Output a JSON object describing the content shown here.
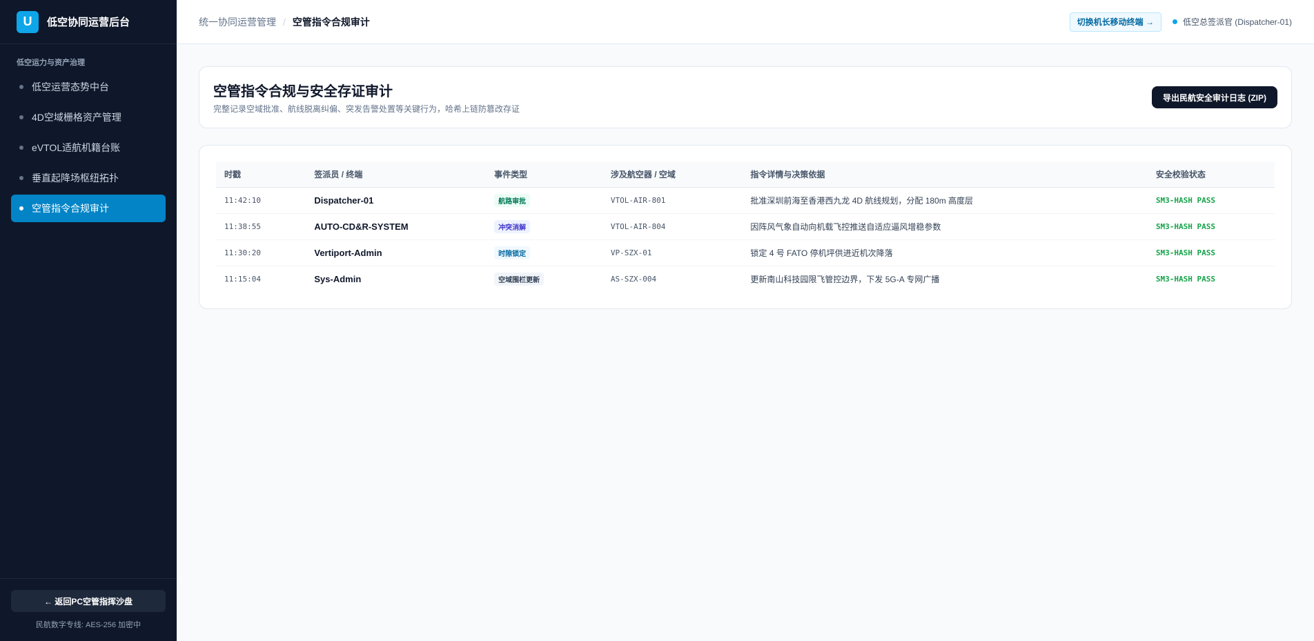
{
  "sidebar": {
    "logo_letter": "U",
    "brand_title": "低空协同运营后台",
    "section_title": "低空运力与资产治理",
    "items": [
      {
        "label": "低空运营态势中台",
        "active": false
      },
      {
        "label": "4D空域栅格资产管理",
        "active": false
      },
      {
        "label": "eVTOL适航机籍台账",
        "active": false
      },
      {
        "label": "垂直起降场枢纽拓扑",
        "active": false
      },
      {
        "label": "空管指令合规审计",
        "active": true
      }
    ],
    "back_button": "← 返回PC空管指挥沙盘",
    "footer_note": "民航数字专线: AES-256 加密中"
  },
  "topbar": {
    "breadcrumb_parent": "统一协同运营管理",
    "breadcrumb_sep": "/",
    "breadcrumb_current": "空管指令合规审计",
    "switch_button": "切换机长移动终端 →",
    "user_label": "低空总签派官 (Dispatcher-01)"
  },
  "header": {
    "title": "空管指令合规与安全存证审计",
    "subtitle": "完整记录空域批准、航线脱离纠偏、突发告警处置等关键行为，哈希上链防篡改存证",
    "export_button": "导出民航安全审计日志 (ZIP)"
  },
  "table": {
    "columns": [
      "时戳",
      "签派员 / 终端",
      "事件类型",
      "涉及航空器 / 空域",
      "指令详情与决策依据",
      "安全校验状态"
    ],
    "rows": [
      {
        "time": "11:42:10",
        "operator": "Dispatcher-01",
        "event": "航路审批",
        "event_style": "green",
        "target": "VTOL-AIR-801",
        "detail": "批准深圳前海至香港西九龙 4D 航线规划，分配 180m 高度层",
        "status": "SM3-HASH PASS"
      },
      {
        "time": "11:38:55",
        "operator": "AUTO-CD&R-SYSTEM",
        "event": "冲突消解",
        "event_style": "indigo",
        "target": "VTOL-AIR-804",
        "detail": "因阵风气象自动向机载飞控推送自适应逼风增稳参数",
        "status": "SM3-HASH PASS"
      },
      {
        "time": "11:30:20",
        "operator": "Vertiport-Admin",
        "event": "时隙锁定",
        "event_style": "sky",
        "target": "VP-SZX-01",
        "detail": "锁定 4 号 FATO 停机坪供进近机次降落",
        "status": "SM3-HASH PASS"
      },
      {
        "time": "11:15:04",
        "operator": "Sys-Admin",
        "event": "空域围栏更新",
        "event_style": "slate",
        "target": "AS-SZX-004",
        "detail": "更新南山科技园限飞管控边界，下发 5G-A 专网广播",
        "status": "SM3-HASH PASS"
      }
    ]
  }
}
